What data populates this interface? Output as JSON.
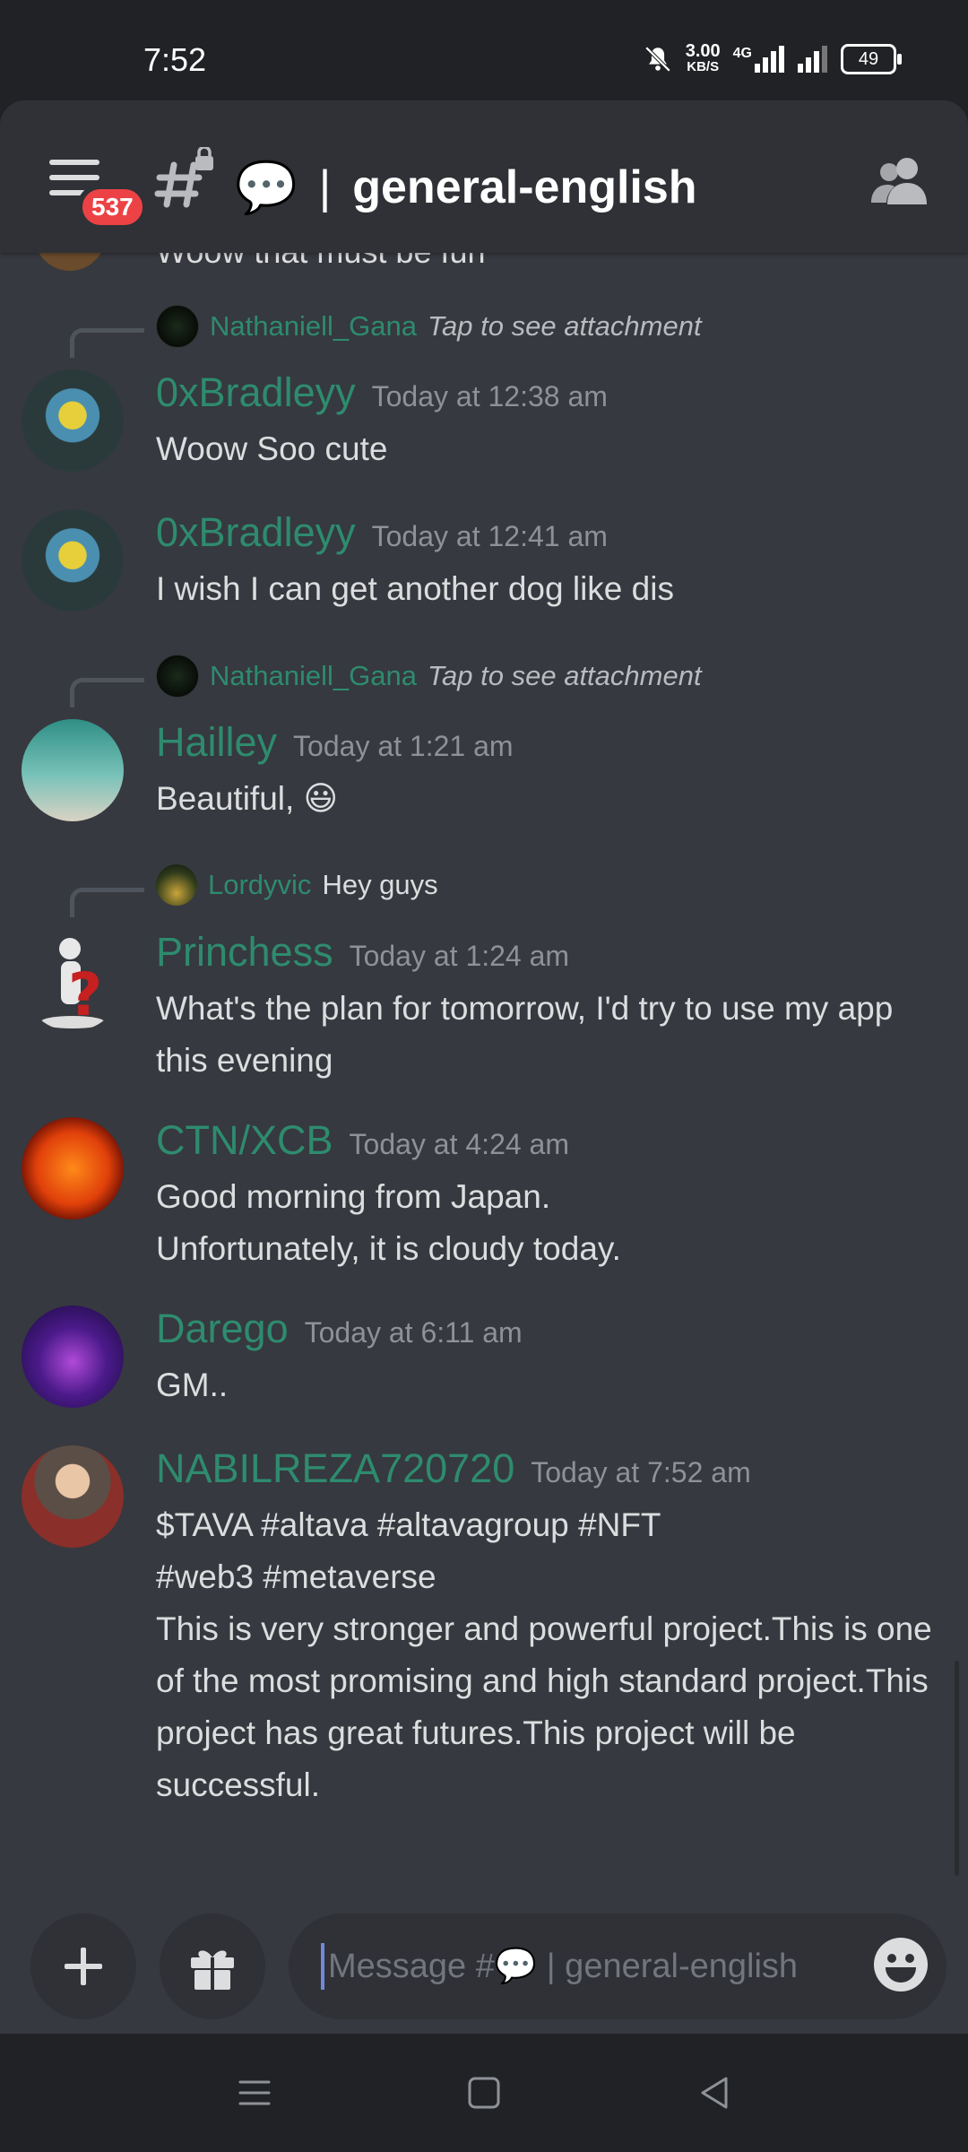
{
  "status_bar": {
    "time": "7:52",
    "speed_value": "3.00",
    "speed_unit": "KB/S",
    "network": "4G",
    "battery": "49"
  },
  "header": {
    "notification_count": "537",
    "channel_emoji": "💬",
    "channel_separator": "|",
    "channel_name": "general-english"
  },
  "cut_message": "Woow that must be fun",
  "messages": [
    {
      "reply": {
        "name": "Nathaniell_Gana",
        "text": "Tap to see attachment"
      },
      "username": "0xBradleyy",
      "time": "Today at 12:38 am",
      "body": "Woow Soo cute"
    },
    {
      "username": "0xBradleyy",
      "time": "Today at 12:41 am",
      "body": "I wish I can get another dog like dis"
    },
    {
      "reply": {
        "name": "Nathaniell_Gana",
        "text": "Tap to see attachment"
      },
      "username": "Hailley",
      "time": "Today at 1:21 am",
      "body": "Beautiful, 😃"
    },
    {
      "reply": {
        "name": "Lordyvic",
        "text": "Hey guys"
      },
      "username": "Princhess",
      "time": "Today at 1:24 am",
      "body": "What's the plan for tomorrow, I'd try to use my app this evening"
    },
    {
      "username": "CTN/XCB",
      "time": "Today at 4:24 am",
      "body": "Good morning from Japan.\nUnfortunately, it is cloudy today."
    },
    {
      "username": "Darego",
      "time": "Today at 6:11 am",
      "body": "GM.."
    },
    {
      "username": "NABILREZA720720",
      "time": "Today at 7:52 am",
      "body": "$TAVA #altava #altavagroup #NFT\n#web3 #metaverse\nThis is very stronger and powerful project.This is one of the most promising and high standard project.This project has great futures.This project will be successful."
    }
  ],
  "composer": {
    "placeholder": "Message #💬 | general-english",
    "add_icon": "plus-icon",
    "gift_icon": "gift-icon",
    "emoji_icon": "smiley-icon"
  },
  "colors": {
    "background": "#36393f",
    "header": "#2f3136",
    "username": "#2e8b6e",
    "badge": "#ed4245"
  }
}
